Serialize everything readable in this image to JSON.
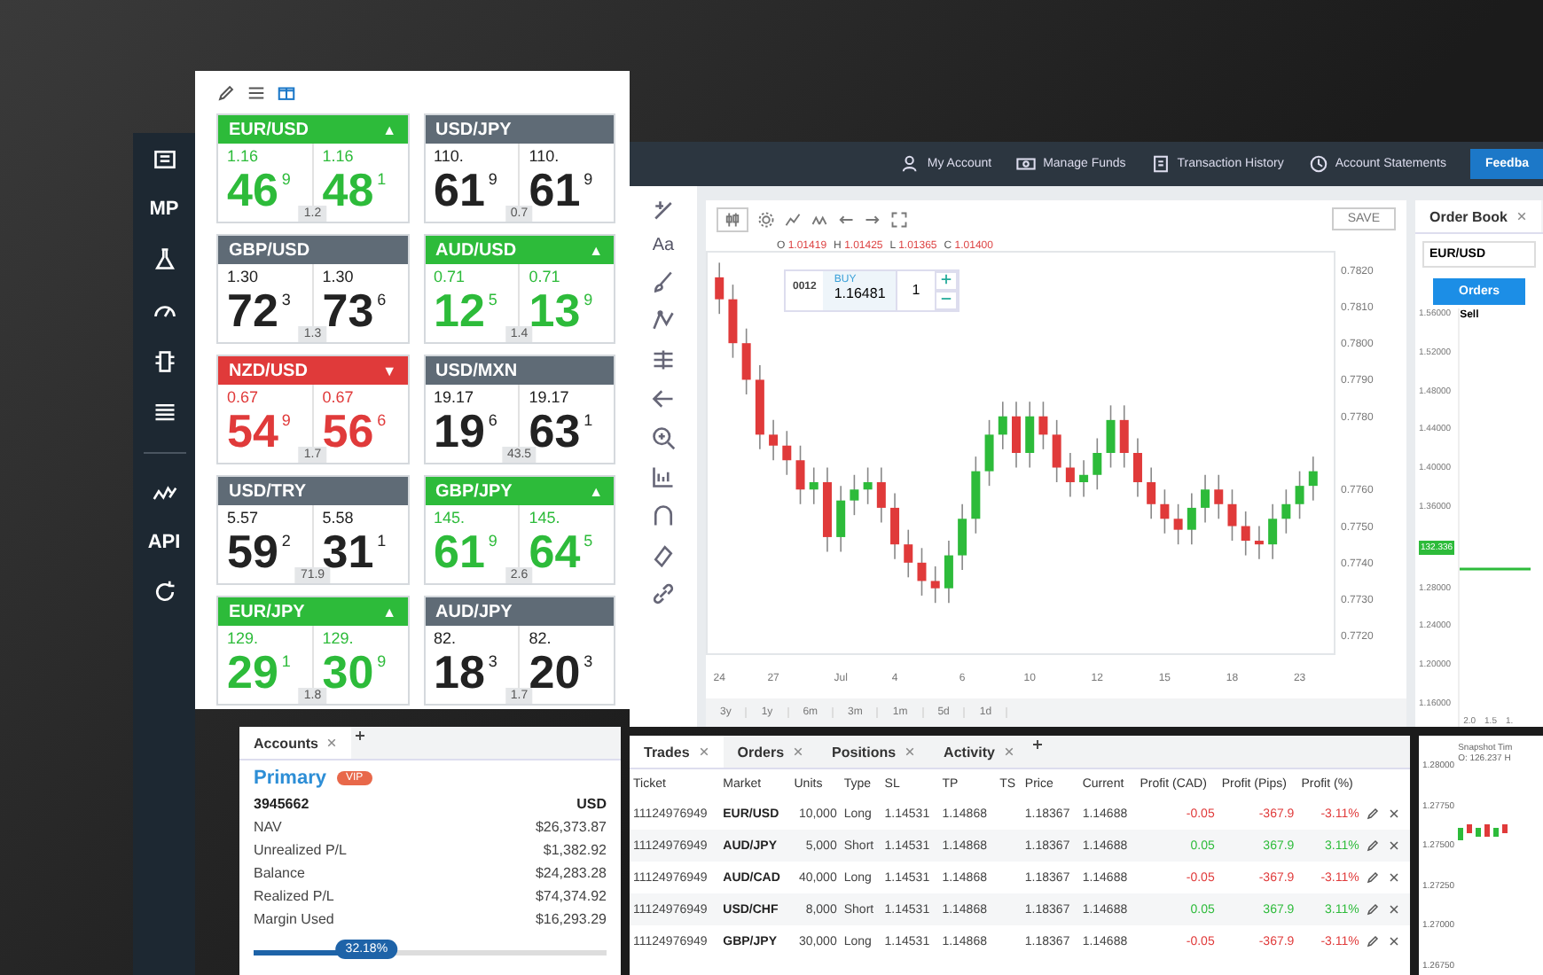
{
  "sidebar": {
    "mp_label": "MP",
    "api_label": "API"
  },
  "tiles": [
    {
      "pair": "EUR/USD",
      "color": "#2dbb3a",
      "highlight": true,
      "arrow": "▲",
      "bid": {
        "lead": "1.16",
        "big": "46",
        "sup": "9"
      },
      "ask": {
        "lead": "1.16",
        "big": "48",
        "sup": "1"
      },
      "spread": "1.2"
    },
    {
      "pair": "USD/JPY",
      "color": "#5f6b76",
      "highlight": false,
      "bid": {
        "lead": "110.",
        "big": "61",
        "sup": "9"
      },
      "ask": {
        "lead": "110.",
        "big": "61",
        "sup": "9"
      },
      "spread": "0.7"
    },
    {
      "pair": "GBP/USD",
      "color": "#5f6b76",
      "highlight": false,
      "bid": {
        "lead": "1.30",
        "big": "72",
        "sup": "3"
      },
      "ask": {
        "lead": "1.30",
        "big": "73",
        "sup": "6"
      },
      "spread": "1.3"
    },
    {
      "pair": "AUD/USD",
      "color": "#2dbb3a",
      "highlight": true,
      "arrow": "▲",
      "bid": {
        "lead": "0.71",
        "big": "12",
        "sup": "5"
      },
      "ask": {
        "lead": "0.71",
        "big": "13",
        "sup": "9"
      },
      "spread": "1.4"
    },
    {
      "pair": "NZD/USD",
      "color": "#e03a3a",
      "highlight": true,
      "arrow": "▼",
      "bid": {
        "lead": "0.67",
        "big": "54",
        "sup": "9"
      },
      "ask": {
        "lead": "0.67",
        "big": "56",
        "sup": "6"
      },
      "spread": "1.7"
    },
    {
      "pair": "USD/MXN",
      "color": "#5f6b76",
      "highlight": false,
      "bid": {
        "lead": "19.17",
        "big": "19",
        "sup": "6"
      },
      "ask": {
        "lead": "19.17",
        "big": "63",
        "sup": "1"
      },
      "spread": "43.5"
    },
    {
      "pair": "USD/TRY",
      "color": "#5f6b76",
      "highlight": false,
      "bid": {
        "lead": "5.57",
        "big": "59",
        "sup": "2"
      },
      "ask": {
        "lead": "5.58",
        "big": "31",
        "sup": "1"
      },
      "spread": "71.9"
    },
    {
      "pair": "GBP/JPY",
      "color": "#2dbb3a",
      "highlight": true,
      "arrow": "▲",
      "bid": {
        "lead": "145.",
        "big": "61",
        "sup": "9"
      },
      "ask": {
        "lead": "145.",
        "big": "64",
        "sup": "5"
      },
      "spread": "2.6"
    },
    {
      "pair": "EUR/JPY",
      "color": "#2dbb3a",
      "highlight": true,
      "arrow": "▲",
      "bid": {
        "lead": "129.",
        "big": "29",
        "sup": "1"
      },
      "ask": {
        "lead": "129.",
        "big": "30",
        "sup": "9"
      },
      "spread": "1.8"
    },
    {
      "pair": "AUD/JPY",
      "color": "#5f6b76",
      "highlight": false,
      "bid": {
        "lead": "82.",
        "big": "18",
        "sup": "3"
      },
      "ask": {
        "lead": "82.",
        "big": "20",
        "sup": "3"
      },
      "spread": "1.7"
    }
  ],
  "top_nav": {
    "items": [
      "My Account",
      "Manage Funds",
      "Transaction History",
      "Account Statements"
    ],
    "feedback": "Feedba"
  },
  "drawing_tools": {
    "text_tool": "Aa"
  },
  "chart": {
    "save": "SAVE",
    "ohlc": [
      {
        "key": "O",
        "value": "1.01419"
      },
      {
        "key": "H",
        "value": "1.01425"
      },
      {
        "key": "L",
        "value": "1.01365"
      },
      {
        "key": "C",
        "value": "1.01400"
      }
    ],
    "sell_price": "0012",
    "buy_label": "BUY",
    "buy_price": "1.16481",
    "quantity": "1",
    "chart_data": {
      "type": "candlestick",
      "categories": [
        "24",
        null,
        null,
        null,
        "27",
        null,
        null,
        null,
        null,
        "Jul",
        null,
        null,
        null,
        "4",
        null,
        null,
        null,
        null,
        "6",
        null,
        null,
        null,
        null,
        "10",
        null,
        null,
        null,
        null,
        "12",
        null,
        null,
        null,
        null,
        "15",
        null,
        null,
        null,
        null,
        "18",
        null,
        null,
        null,
        null,
        "23",
        null
      ],
      "ohlc": [
        [
          0.7818,
          0.7822,
          0.7808,
          0.7812
        ],
        [
          0.7812,
          0.7816,
          0.7796,
          0.78
        ],
        [
          0.78,
          0.7804,
          0.7786,
          0.779
        ],
        [
          0.779,
          0.7794,
          0.7771,
          0.7775
        ],
        [
          0.7775,
          0.7779,
          0.7768,
          0.7772
        ],
        [
          0.7772,
          0.7776,
          0.7764,
          0.7768
        ],
        [
          0.7768,
          0.7772,
          0.7756,
          0.776
        ],
        [
          0.776,
          0.7766,
          0.7756,
          0.7762
        ],
        [
          0.7762,
          0.7766,
          0.7743,
          0.7747
        ],
        [
          0.7747,
          0.7761,
          0.7743,
          0.7757
        ],
        [
          0.7757,
          0.7764,
          0.7753,
          0.776
        ],
        [
          0.776,
          0.7766,
          0.7756,
          0.7762
        ],
        [
          0.7762,
          0.7766,
          0.7751,
          0.7755
        ],
        [
          0.7755,
          0.7759,
          0.7741,
          0.7745
        ],
        [
          0.7745,
          0.7749,
          0.7736,
          0.774
        ],
        [
          0.774,
          0.7744,
          0.7731,
          0.7735
        ],
        [
          0.7735,
          0.7739,
          0.7729,
          0.7733
        ],
        [
          0.7733,
          0.7746,
          0.7729,
          0.7742
        ],
        [
          0.7742,
          0.7756,
          0.7738,
          0.7752
        ],
        [
          0.7752,
          0.7769,
          0.7748,
          0.7765
        ],
        [
          0.7765,
          0.7779,
          0.7761,
          0.7775
        ],
        [
          0.7775,
          0.7784,
          0.7771,
          0.778
        ],
        [
          0.778,
          0.7784,
          0.7766,
          0.777
        ],
        [
          0.777,
          0.7784,
          0.7766,
          0.778
        ],
        [
          0.778,
          0.7784,
          0.7771,
          0.7775
        ],
        [
          0.7775,
          0.7779,
          0.7762,
          0.7766
        ],
        [
          0.7766,
          0.777,
          0.7758,
          0.7762
        ],
        [
          0.7762,
          0.7768,
          0.7758,
          0.7764
        ],
        [
          0.7764,
          0.7774,
          0.776,
          0.777
        ],
        [
          0.777,
          0.7783,
          0.7766,
          0.7779
        ],
        [
          0.7779,
          0.7783,
          0.7766,
          0.777
        ],
        [
          0.777,
          0.7774,
          0.7758,
          0.7762
        ],
        [
          0.7762,
          0.7766,
          0.7752,
          0.7756
        ],
        [
          0.7756,
          0.776,
          0.7748,
          0.7752
        ],
        [
          0.7752,
          0.7756,
          0.7745,
          0.7749
        ],
        [
          0.7749,
          0.7759,
          0.7745,
          0.7755
        ],
        [
          0.7755,
          0.7764,
          0.7751,
          0.776
        ],
        [
          0.776,
          0.7764,
          0.7752,
          0.7756
        ],
        [
          0.7756,
          0.776,
          0.7746,
          0.775
        ],
        [
          0.775,
          0.7754,
          0.7742,
          0.7746
        ],
        [
          0.7746,
          0.775,
          0.7741,
          0.7745
        ],
        [
          0.7745,
          0.7756,
          0.7741,
          0.7752
        ],
        [
          0.7752,
          0.776,
          0.7748,
          0.7756
        ],
        [
          0.7756,
          0.7765,
          0.7752,
          0.7761
        ],
        [
          0.7761,
          0.7769,
          0.7757,
          0.7765
        ]
      ],
      "ylim": [
        0.7715,
        0.7825
      ],
      "yticks": [
        {
          "value": 0.782,
          "label": "0.7820"
        },
        {
          "value": 0.781,
          "label": "0.7810"
        },
        {
          "value": 0.78,
          "label": "0.7800"
        },
        {
          "value": 0.779,
          "label": "0.7790"
        },
        {
          "value": 0.778,
          "label": "0.7780"
        },
        {
          "value": 0.776,
          "label": "0.7760"
        },
        {
          "value": 0.775,
          "label": "0.7750"
        },
        {
          "value": 0.774,
          "label": "0.7740"
        },
        {
          "value": 0.773,
          "label": "0.7730"
        },
        {
          "value": 0.772,
          "label": "0.7720"
        }
      ]
    },
    "ranges": [
      "3y",
      "1y",
      "6m",
      "3m",
      "1m",
      "5d",
      "1d"
    ]
  },
  "order_book": {
    "tab": {
      "label": "Order Book",
      "selected": true
    },
    "symbol": "EUR/USD",
    "orders_button": "Orders",
    "side": "Sell",
    "price_axis": [
      "1.56000",
      "1.52000",
      "1.48000",
      "1.44000",
      "1.40000",
      "1.36000",
      "132.336",
      "1.28000",
      "1.24000",
      "1.20000",
      "1.16000"
    ],
    "depth_axis": [
      "2.0",
      "1.5",
      "1."
    ]
  },
  "accounts": {
    "tab": {
      "label": "Accounts",
      "selected": true
    },
    "name": "Primary",
    "badge": "VIP",
    "number": "3945662",
    "currency": "USD",
    "rows": [
      {
        "label": "NAV",
        "value": "$26,373.87"
      },
      {
        "label": "Unrealized P/L",
        "value": "$1,382.92"
      },
      {
        "label": "Balance",
        "value": "$24,283.28"
      },
      {
        "label": "Realized P/L",
        "value": "$74,374.92"
      },
      {
        "label": "Margin Used",
        "value": "$16,293.29"
      }
    ],
    "margin": {
      "level": 0.32,
      "reading": "32.18%"
    }
  },
  "trades": {
    "tabs": [
      {
        "label": "Trades",
        "selected": true
      },
      {
        "label": "Orders",
        "selected": false
      },
      {
        "label": "Positions",
        "selected": false
      },
      {
        "label": "Activity",
        "selected": false
      }
    ],
    "columns": [
      "Ticket",
      "Market",
      "Units",
      "Type",
      "SL",
      "TP",
      "TS",
      "Price",
      "Current",
      "Profit (CAD)",
      "Profit (Pips)",
      "Profit (%)"
    ],
    "rows": [
      {
        "ticket": "11124976949",
        "market": "EUR/USD",
        "units": "10,000",
        "type": "Long",
        "sl": "1.14531",
        "tp": "1.14868",
        "price": "1.18367",
        "current": "1.14688",
        "profit_cad": "-0.05",
        "profit_pips": "-367.9",
        "profit_pct": "-3.11%",
        "profit_positive": false
      },
      {
        "ticket": "11124976949",
        "market": "AUD/JPY",
        "units": "5,000",
        "type": "Short",
        "sl": "1.14531",
        "tp": "1.14868",
        "price": "1.18367",
        "current": "1.14688",
        "profit_cad": "0.05",
        "profit_pips": "367.9",
        "profit_pct": "3.11%",
        "profit_positive": true
      },
      {
        "ticket": "11124976949",
        "market": "AUD/CAD",
        "units": "40,000",
        "type": "Long",
        "sl": "1.14531",
        "tp": "1.14868",
        "price": "1.18367",
        "current": "1.14688",
        "profit_cad": "-0.05",
        "profit_pips": "-367.9",
        "profit_pct": "-3.11%",
        "profit_positive": false
      },
      {
        "ticket": "11124976949",
        "market": "USD/CHF",
        "units": "8,000",
        "type": "Short",
        "sl": "1.14531",
        "tp": "1.14868",
        "price": "1.18367",
        "current": "1.14688",
        "profit_cad": "0.05",
        "profit_pips": "367.9",
        "profit_pct": "3.11%",
        "profit_positive": true
      },
      {
        "ticket": "11124976949",
        "market": "GBP/JPY",
        "units": "30,000",
        "type": "Long",
        "sl": "1.14531",
        "tp": "1.14868",
        "price": "1.18367",
        "current": "1.14688",
        "profit_cad": "-0.05",
        "profit_pips": "-367.9",
        "profit_pct": "-3.11%",
        "profit_positive": false
      }
    ]
  },
  "snapshot": {
    "title": "Snapshot Tim",
    "ohlc": "O: 126.237  H",
    "price_axis": [
      "1.28000",
      "1.27750",
      "1.27500",
      "1.27250",
      "1.27000",
      "1.26750"
    ]
  }
}
